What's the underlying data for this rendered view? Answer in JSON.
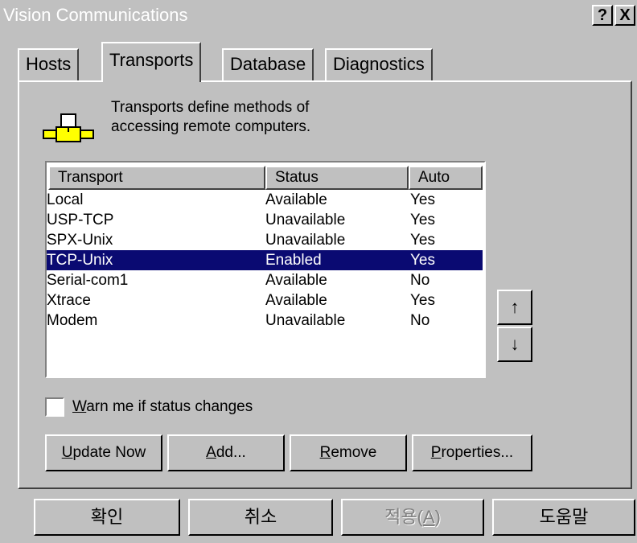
{
  "window": {
    "title": "Vision Communications",
    "help_label": "?",
    "close_label": "X"
  },
  "tabs": [
    {
      "label": "Hosts"
    },
    {
      "label": "Transports"
    },
    {
      "label": "Database"
    },
    {
      "label": "Diagnostics"
    }
  ],
  "description": {
    "line1": "Transports define methods of",
    "line2": "accessing remote computers."
  },
  "transport_list": {
    "columns": [
      "Transport",
      "Status",
      "Auto"
    ],
    "rows": [
      [
        "Local",
        "Available",
        "Yes"
      ],
      [
        "USP-TCP",
        "Unavailable",
        "Yes"
      ],
      [
        "SPX-Unix",
        "Unavailable",
        "Yes"
      ],
      [
        "TCP-Unix",
        "Enabled",
        "Yes"
      ],
      [
        "Serial-com1",
        "Available",
        "No"
      ],
      [
        "Xtrace",
        "Available",
        "Yes"
      ],
      [
        "Modem",
        "Unavailable",
        "No"
      ]
    ],
    "selected_index": 3
  },
  "move_buttons": {
    "up_label": "↑",
    "down_label": "↓"
  },
  "warn_checkbox": {
    "accel": "W",
    "rest": "arn me if status changes",
    "checked": false
  },
  "action_buttons": {
    "update": {
      "accel": "U",
      "rest": "pdate Now"
    },
    "add": {
      "accel": "A",
      "rest": "dd..."
    },
    "remove": {
      "accel": "R",
      "rest": "emove"
    },
    "properties": {
      "accel": "P",
      "rest": "roperties..."
    }
  },
  "dialog_buttons": {
    "ok": "확인",
    "cancel": "취소",
    "apply_prefix": "적용(",
    "apply_accel": "A",
    "apply_suffix": ")",
    "help": "도움말"
  },
  "colors": {
    "face": "#c0c0c0",
    "selection": "#0a0a72",
    "list_bg": "#ffffff"
  }
}
